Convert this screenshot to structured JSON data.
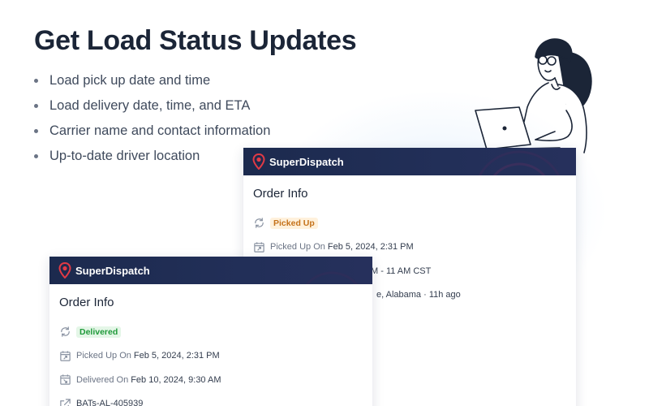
{
  "headline": "Get Load Status Updates",
  "features": [
    "Load pick up date and time",
    "Load delivery date, time, and ETA",
    "Carrier name and contact information",
    "Up-to-date driver location"
  ],
  "brand": "SuperDispatch",
  "colors": {
    "header_navy": "#1c2a4e",
    "brand_pin": "#e23a45",
    "picked_badge_bg": "#fff1dc",
    "picked_badge_text": "#c5721a",
    "delivered_badge_bg": "#e4f6e7",
    "delivered_badge_text": "#1f9a3a"
  },
  "back_card": {
    "title": "Order Info",
    "status": "Picked Up",
    "status_icon": "sync-icon",
    "picked_label": "Picked Up On",
    "picked_value": "Feb 5, 2024, 2:31 PM",
    "eta_partial": "M - 11 AM CST",
    "location_partial": "e, Alabama · 11h ago"
  },
  "front_card": {
    "title": "Order Info",
    "status": "Delivered",
    "status_icon": "sync-icon",
    "picked_label": "Picked Up On",
    "picked_value": "Feb 5, 2024, 2:31 PM",
    "delivered_label": "Delivered On",
    "delivered_value": "Feb 10, 2024, 9:30 AM",
    "order_number": "BATs-AL-405939"
  }
}
